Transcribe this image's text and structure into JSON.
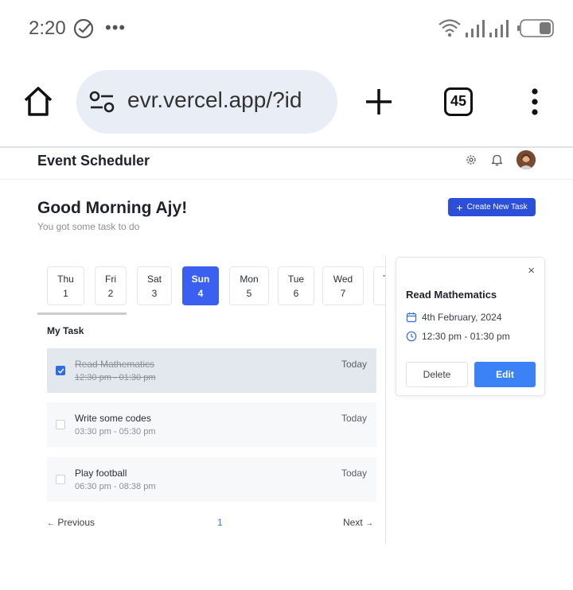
{
  "status": {
    "time": "2:20",
    "more": "•••"
  },
  "browser": {
    "url": "evr.vercel.app/?id",
    "tab_count": "45"
  },
  "app": {
    "title": "Event Scheduler"
  },
  "greeting": {
    "title": "Good Morning Ajy!",
    "subtitle": "You got some task to do"
  },
  "create_button": {
    "label": "Create New Task"
  },
  "days": [
    {
      "name": "Thu",
      "num": "1"
    },
    {
      "name": "Fri",
      "num": "2"
    },
    {
      "name": "Sat",
      "num": "3"
    },
    {
      "name": "Sun",
      "num": "4",
      "active": true
    },
    {
      "name": "Mon",
      "num": "5"
    },
    {
      "name": "Tue",
      "num": "6"
    },
    {
      "name": "Wed",
      "num": "7"
    },
    {
      "name": "T",
      "num": ""
    }
  ],
  "tasks_section": {
    "heading": "My Task"
  },
  "tasks": [
    {
      "title": "Read Mathematics",
      "time": "12:30 pm - 01:30 pm",
      "day": "Today",
      "completed": true
    },
    {
      "title": "Write some codes",
      "time": "03:30 pm - 05:30 pm",
      "day": "Today",
      "completed": false
    },
    {
      "title": "Play football",
      "time": "06:30 pm - 08:38 pm",
      "day": "Today",
      "completed": false
    }
  ],
  "pagination": {
    "previous": "Previous",
    "current": "1",
    "next": "Next"
  },
  "detail": {
    "close": "×",
    "title": "Read Mathematics",
    "date": "4th February, 2024",
    "time": "12:30 pm - 01:30 pm",
    "delete_label": "Delete",
    "edit_label": "Edit"
  },
  "colors": {
    "accent": "#2b4fd8",
    "active_day": "#3b5ff0",
    "edit_button": "#3b82f6",
    "completed_row": "#e3e7ee"
  }
}
